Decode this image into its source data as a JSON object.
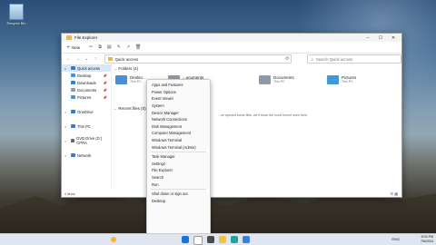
{
  "desktop": {
    "recycle_bin_label": "Recycle Bin"
  },
  "explorer": {
    "title": "File Explorer",
    "new_label": "New",
    "address": "Quick access",
    "search_placeholder": "Search Quick access",
    "folders_header": "Folders (4)",
    "recent_header": "Recent files (0)",
    "recent_message": "...ve opened some files, we'll show the most recent ones here.",
    "status": "4 items",
    "sidebar": [
      {
        "label": "Quick access",
        "chevron": "v",
        "color": "#3a78d4",
        "pinned": false,
        "selected": true
      },
      {
        "label": "Desktop",
        "chevron": "",
        "color": "#4a90d9",
        "pinned": true,
        "selected": false
      },
      {
        "label": "Downloads",
        "chevron": "",
        "color": "#2f80d1",
        "pinned": true,
        "selected": false
      },
      {
        "label": "Documents",
        "chevron": "",
        "color": "#8e9aa8",
        "pinned": true,
        "selected": false
      },
      {
        "label": "Pictures",
        "chevron": "",
        "color": "#3f9ad6",
        "pinned": true,
        "selected": false
      },
      {
        "label": "",
        "chevron": "",
        "color": "",
        "pinned": false,
        "selected": false
      },
      {
        "label": "OneDrive",
        "chevron": ">",
        "color": "#2b7cd3",
        "pinned": false,
        "selected": false
      },
      {
        "label": "",
        "chevron": "",
        "color": "",
        "pinned": false,
        "selected": false
      },
      {
        "label": "This PC",
        "chevron": ">",
        "color": "#3a78d4",
        "pinned": false,
        "selected": false
      },
      {
        "label": "",
        "chevron": "",
        "color": "",
        "pinned": false,
        "selected": false
      },
      {
        "label": "DVD Drive (D:) CPRA",
        "chevron": ">",
        "color": "#666666",
        "pinned": false,
        "selected": false
      },
      {
        "label": "",
        "chevron": "",
        "color": "",
        "pinned": false,
        "selected": false
      },
      {
        "label": "Network",
        "chevron": ">",
        "color": "#3a78d4",
        "pinned": false,
        "selected": false
      }
    ],
    "folders": [
      {
        "name": "Deskto...",
        "sub": "This PC",
        "color": "#4a90d9"
      },
      {
        "name": "...ocuments",
        "sub": "This PC",
        "color": "#8e9aa8"
      },
      {
        "name": "Documents",
        "sub": "This PC",
        "color": "#8e9aa8"
      },
      {
        "name": "Pictures",
        "sub": "This PC",
        "color": "#3f9ad6"
      }
    ]
  },
  "context_menu": {
    "items": [
      "Apps and Features",
      "Power Options",
      "Event Viewer",
      "System",
      "Device Manager",
      "Network Connections",
      "Disk Management",
      "Computer Management",
      "Windows Terminal",
      "Windows Terminal (Admin)",
      "",
      "Task Manager",
      "Settings",
      "File Explorer",
      "Search",
      "Run",
      "",
      "Shut down or sign out",
      "Desktop"
    ]
  },
  "taskbar": {
    "time": "8:04 PM",
    "date": "7/6/2024",
    "sys": "ENG"
  }
}
